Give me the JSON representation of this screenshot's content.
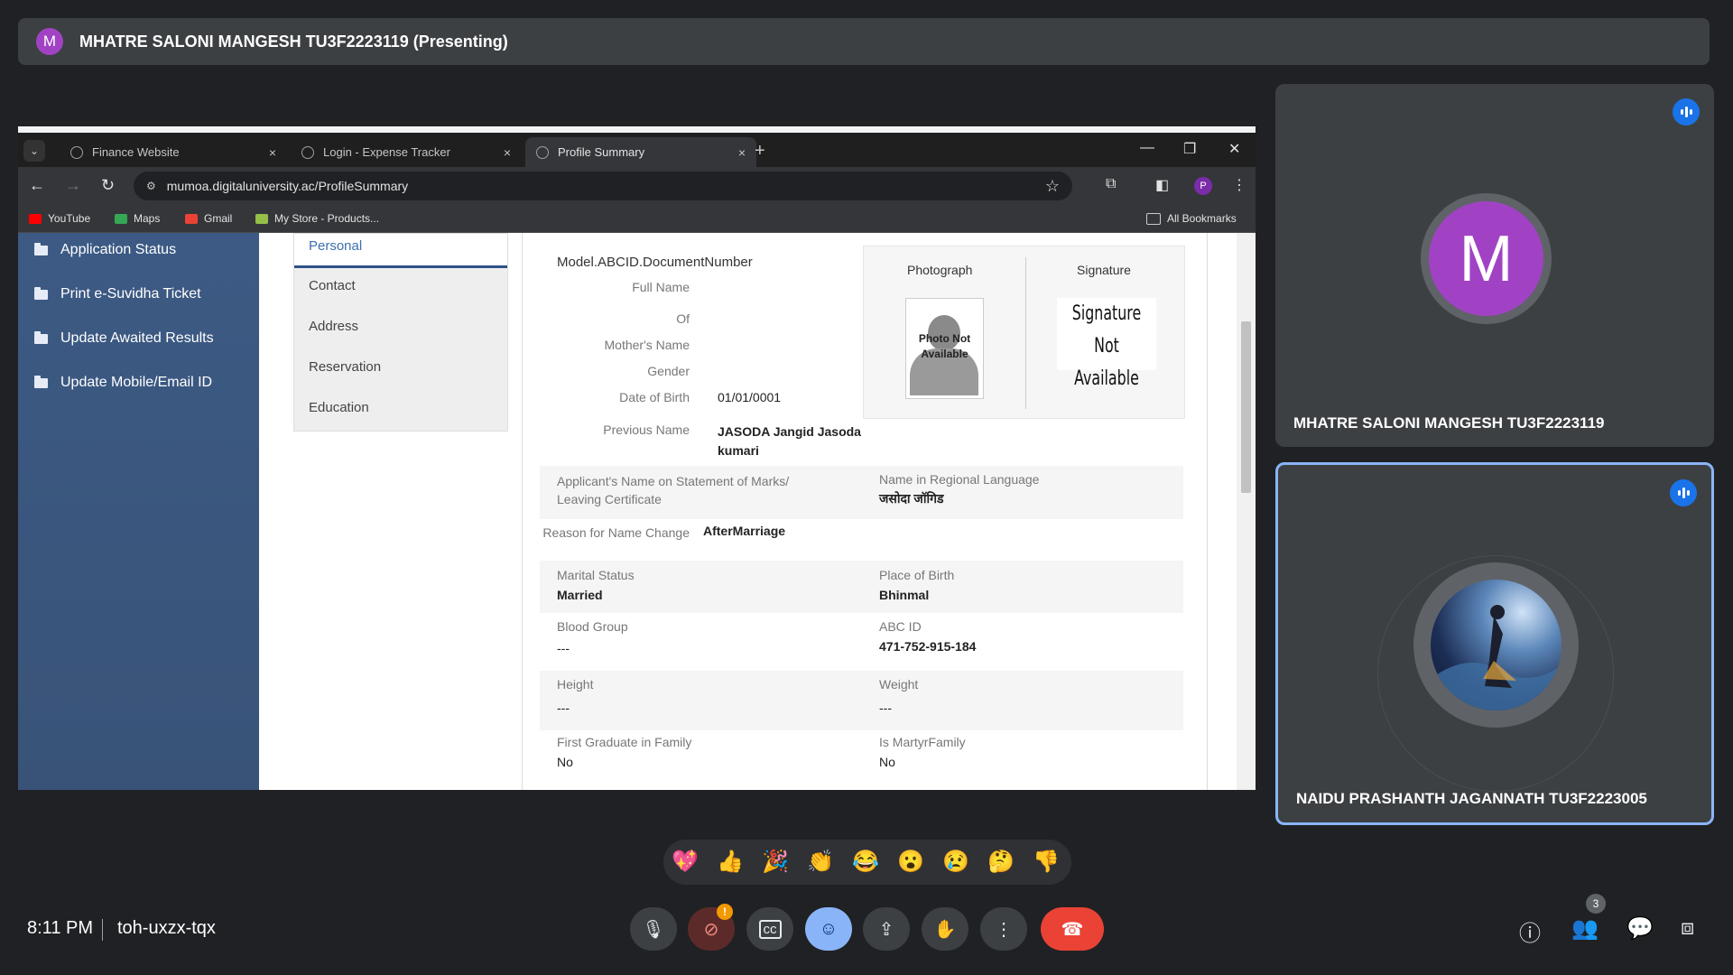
{
  "banner": {
    "avatar": "M",
    "text": "MHATRE SALONI MANGESH TU3F2223119 (Presenting)"
  },
  "browser": {
    "tabs": [
      {
        "title": "Finance Website"
      },
      {
        "title": "Login - Expense Tracker"
      },
      {
        "title": "Profile Summary"
      }
    ],
    "close_glyph": "×",
    "newtab_glyph": "+",
    "url": "mumoa.digitaluniversity.ac/ProfileSummary",
    "profile_letter": "P",
    "bookmarks": [
      "YouTube",
      "Maps",
      "Gmail",
      "My Store - Products..."
    ],
    "all_bookmarks": "All Bookmarks"
  },
  "page": {
    "side_menu": [
      "Application Status",
      "Print e-Suvidha Ticket",
      "Update Awaited Results",
      "Update Mobile/Email ID"
    ],
    "tabs": [
      "Personal",
      "Contact",
      "Address",
      "Reservation",
      "Education"
    ],
    "doc_number": "Model.ABCID.DocumentNumber",
    "labels": {
      "full_name": "Full Name",
      "of": "Of",
      "mother": "Mother's Name",
      "gender": "Gender",
      "dob": "Date of Birth",
      "previous_name": "Previous Name",
      "applicant_name": "Applicant's Name on Statement of Marks/ Leaving Certificate",
      "regional_name": "Name in Regional Language",
      "reason": "Reason for Name Change",
      "marital": "Marital Status",
      "place_birth": "Place of Birth",
      "blood": "Blood Group",
      "abc_id": "ABC ID",
      "height": "Height",
      "weight": "Weight",
      "first_grad": "First Graduate in Family",
      "martyr": "Is MartyrFamily"
    },
    "values": {
      "dob": "01/01/0001",
      "previous_name": "JASODA Jangid Jasoda kumari",
      "regional_name": "जसोदा जॉगिड",
      "reason": "AfterMarriage",
      "marital": "Married",
      "place_birth": "Bhinmal",
      "blood": "---",
      "abc_id": "471-752-915-184",
      "height": "---",
      "weight": "---",
      "first_grad": "No",
      "martyr": "No"
    },
    "photo_header": "Photograph",
    "signature_header": "Signature",
    "photo_placeholder": "Photo Not Available",
    "signature_placeholder": "Signature Not Available"
  },
  "tiles": [
    {
      "avatar": "M",
      "name": "MHATRE SALONI MANGESH TU3F2223119",
      "avatar_color": "#a142c4"
    },
    {
      "name": "NAIDU PRASHANTH JAGANNATH TU3F2223005"
    }
  ],
  "reactions": [
    "💖",
    "👍",
    "🎉",
    "👏",
    "😂",
    "😮",
    "😢",
    "🤔",
    "👎"
  ],
  "footer": {
    "time": "8:11 PM",
    "meeting_code": "toh-uxzx-tqx",
    "participants_count": "3",
    "cam_alert": "!"
  },
  "colors": {
    "accent": "#1a73e8",
    "end_call": "#ea4335",
    "reaction_active": "#8ab4f8"
  }
}
